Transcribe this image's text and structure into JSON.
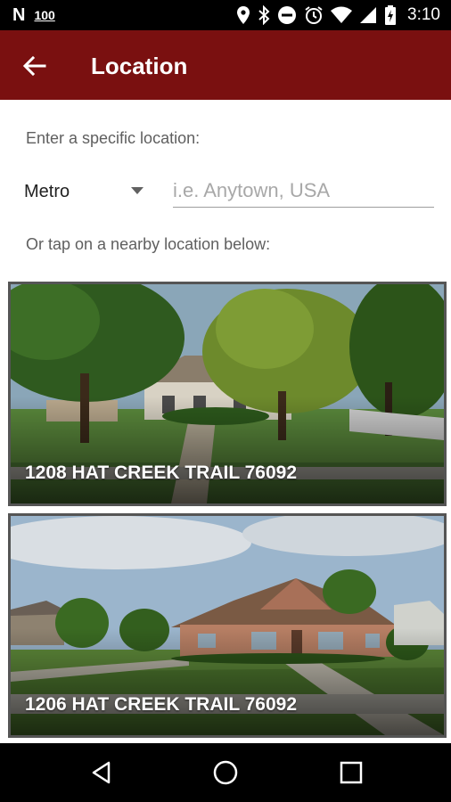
{
  "status_bar": {
    "carrier_mark": "N",
    "signal_label": "100",
    "time": "3:10",
    "icons": [
      "location-icon",
      "bluetooth-icon",
      "do-not-disturb-icon",
      "alarm-icon",
      "wifi-icon",
      "cell-signal-icon",
      "battery-icon"
    ]
  },
  "app_bar": {
    "title": "Location",
    "back_icon": "arrow-back-icon",
    "color": "#7a1010"
  },
  "form": {
    "prompt": "Enter a specific location:",
    "metro_selected": "Metro",
    "location_placeholder": "i.e. Anytown, USA",
    "location_value": "",
    "nearby_prompt": "Or tap on a nearby location below:"
  },
  "nearby_locations": [
    {
      "address": "1208 HAT CREEK TRAIL 76092"
    },
    {
      "address": "1206 HAT CREEK TRAIL 76092"
    }
  ],
  "nav_bar": {
    "icons": [
      "nav-back-icon",
      "nav-home-icon",
      "nav-recents-icon"
    ]
  }
}
